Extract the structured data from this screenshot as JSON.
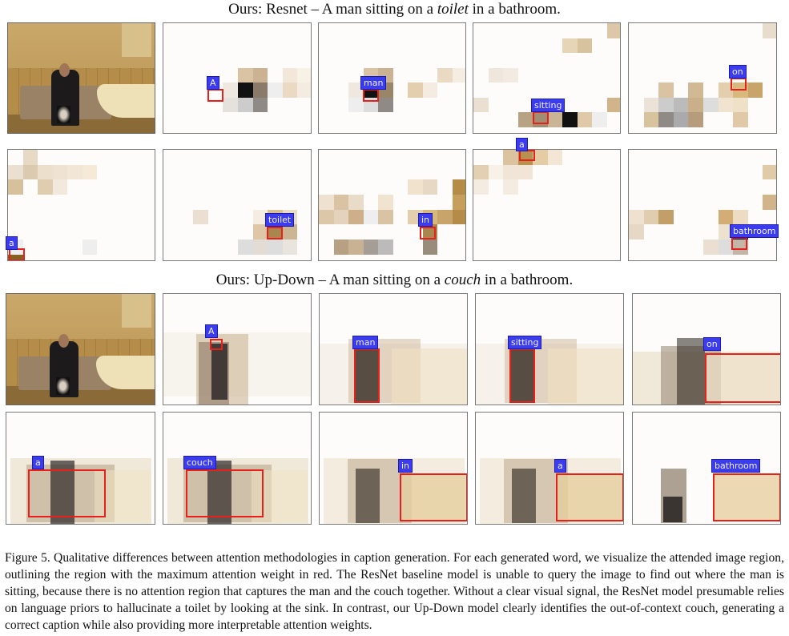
{
  "figure": {
    "rows": [
      {
        "title_prefix": "Ours: Resnet – A man sitting on a ",
        "title_emph": "toilet",
        "title_suffix": " in a bathroom.",
        "model": "Resnet",
        "words": [
          "A",
          "man",
          "sitting",
          "on",
          "a",
          "toilet",
          "in",
          "a",
          "bathroom"
        ]
      },
      {
        "title_prefix": "Ours: Up-Down – A man sitting on a ",
        "title_emph": "couch",
        "title_suffix": " in a bathroom.",
        "model": "Up-Down",
        "words": [
          "A",
          "man",
          "sitting",
          "on",
          "a",
          "couch",
          "in",
          "a",
          "bathroom"
        ]
      }
    ],
    "caption": "Figure 5. Qualitative differences between attention methodologies in caption generation. For each generated word, we visualize the attended image region, outlining the region with the maximum attention weight in red. The ResNet baseline model is unable to query the image to find out where the man is sitting, because there is no attention region that captures the man and the couch together. Without a clear visual signal, the ResNet model presumable relies on language priors to hallucinate a toilet by looking at the sink. In contrast, our Up-Down model clearly identifies the out-of-context couch, generating a correct caption while also providing more interpretable attention weights.",
    "colors": {
      "label_bg": "#3b3bef",
      "label_text": "#f2f2ff",
      "max_attention_box": "#e8201c"
    }
  }
}
